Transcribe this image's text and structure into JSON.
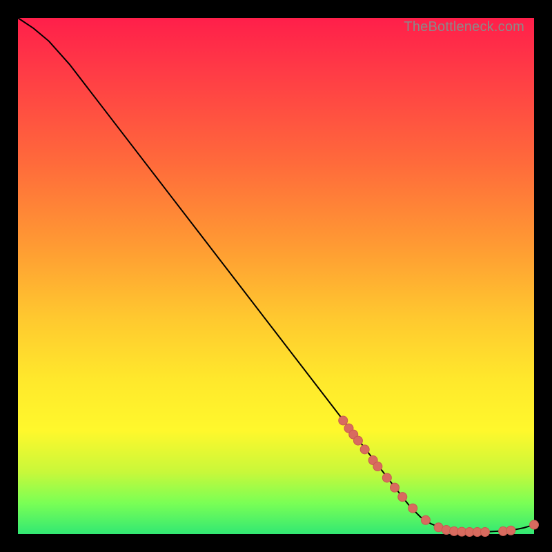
{
  "watermark": "TheBottleneck.com",
  "colors": {
    "page_bg": "#000000",
    "gradient_top": "#ff1f4a",
    "gradient_bottom": "#32e873",
    "curve": "#000000",
    "marker_fill": "#d86b5f",
    "marker_stroke": "#c85b50"
  },
  "chart_data": {
    "type": "line",
    "title": "",
    "xlabel": "",
    "ylabel": "",
    "xlim": [
      0,
      100
    ],
    "ylim": [
      0,
      100
    ],
    "x": [
      0,
      3,
      6,
      10,
      15,
      20,
      25,
      30,
      35,
      40,
      45,
      50,
      55,
      60,
      65,
      70,
      72,
      74,
      76,
      78,
      80,
      82,
      84,
      86,
      88,
      90,
      92,
      94,
      96,
      98,
      100
    ],
    "y": [
      100,
      98,
      95.5,
      91,
      84.5,
      78,
      71.5,
      65,
      58.5,
      52,
      45.5,
      39,
      32.5,
      26,
      19.5,
      13,
      10.4,
      7.8,
      5.3,
      3.3,
      2.0,
      1.2,
      0.7,
      0.4,
      0.4,
      0.4,
      0.5,
      0.6,
      0.8,
      1.2,
      1.8
    ],
    "markers": [
      {
        "x": 63.0,
        "y": 22.0
      },
      {
        "x": 64.1,
        "y": 20.5
      },
      {
        "x": 65.0,
        "y": 19.3
      },
      {
        "x": 65.9,
        "y": 18.1
      },
      {
        "x": 67.2,
        "y": 16.4
      },
      {
        "x": 68.8,
        "y": 14.3
      },
      {
        "x": 69.7,
        "y": 13.1
      },
      {
        "x": 71.5,
        "y": 10.9
      },
      {
        "x": 73.0,
        "y": 9.0
      },
      {
        "x": 74.5,
        "y": 7.2
      },
      {
        "x": 76.5,
        "y": 5.0
      },
      {
        "x": 79.0,
        "y": 2.7
      },
      {
        "x": 81.5,
        "y": 1.3
      },
      {
        "x": 83.0,
        "y": 0.8
      },
      {
        "x": 84.5,
        "y": 0.55
      },
      {
        "x": 86.0,
        "y": 0.45
      },
      {
        "x": 87.5,
        "y": 0.4
      },
      {
        "x": 89.0,
        "y": 0.4
      },
      {
        "x": 90.5,
        "y": 0.4
      },
      {
        "x": 94.0,
        "y": 0.55
      },
      {
        "x": 95.5,
        "y": 0.7
      },
      {
        "x": 100.0,
        "y": 1.8
      }
    ],
    "marker_radius_px": 6.5
  }
}
